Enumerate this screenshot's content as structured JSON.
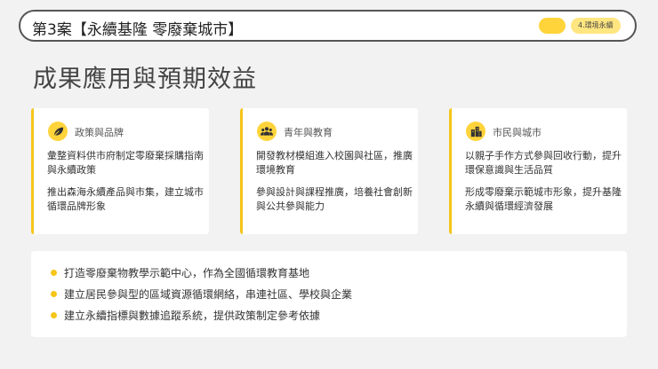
{
  "header": {
    "case_title": "第3案【永續基隆 零廢棄城市】",
    "tag": "4.環境永續"
  },
  "heading": "成果應用與預期效益",
  "cards": [
    {
      "icon": "leaf-icon",
      "title": "政策與品牌",
      "paragraphs": [
        "彙整資料供市府制定零廢棄採購指南與永續政策",
        "推出森海永續產品與市集，建立城市循環品牌形象"
      ]
    },
    {
      "icon": "people-icon",
      "title": "青年與教育",
      "paragraphs": [
        "開發教材模組進入校園與社區，推廣環境教育",
        "參與設計與課程推廣，培養社會創新與公共參與能力"
      ]
    },
    {
      "icon": "city-icon",
      "title": "市民與城市",
      "paragraphs": [
        "以親子手作方式參與回收行動，提升環保意識與生活品質",
        "形成零廢棄示範城市形象，提升基隆永續與循環經濟發展"
      ]
    }
  ],
  "bullets": [
    "打造零廢棄物教學示範中心，作為全國循環教育基地",
    "建立居民參與型的區域資源循環網絡，串連社區、學校與企業",
    "建立永續指標與數據追蹤系統，提供政策制定參考依據"
  ],
  "colors": {
    "accent": "#f5c518",
    "accent_light": "#ffe680",
    "background": "#f2f2f2"
  }
}
